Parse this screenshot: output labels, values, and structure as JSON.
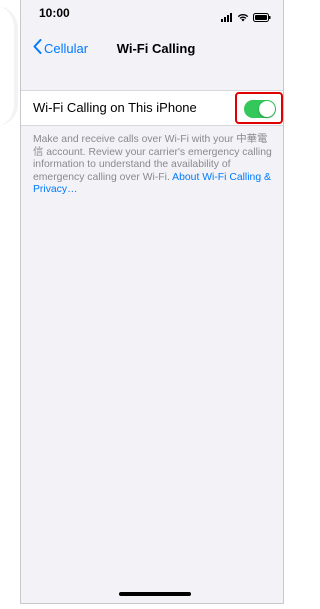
{
  "status_bar": {
    "time": "10:00",
    "icons": [
      "signal-icon",
      "wifi-icon",
      "battery-icon"
    ]
  },
  "nav": {
    "back_label": "Cellular",
    "title": "Wi-Fi Calling"
  },
  "settings": {
    "wifi_calling_label": "Wi-Fi Calling on This iPhone",
    "wifi_calling_enabled": true
  },
  "footer": {
    "text": "Make and receive calls over Wi-Fi with your 中華電信 account. Review your carrier's emergency calling information to understand the availability of emergency calling over Wi-Fi.",
    "link": "About Wi-Fi Calling & Privacy…"
  },
  "colors": {
    "accent": "#007aff",
    "toggle_on": "#34c759",
    "highlight": "#e00000"
  }
}
